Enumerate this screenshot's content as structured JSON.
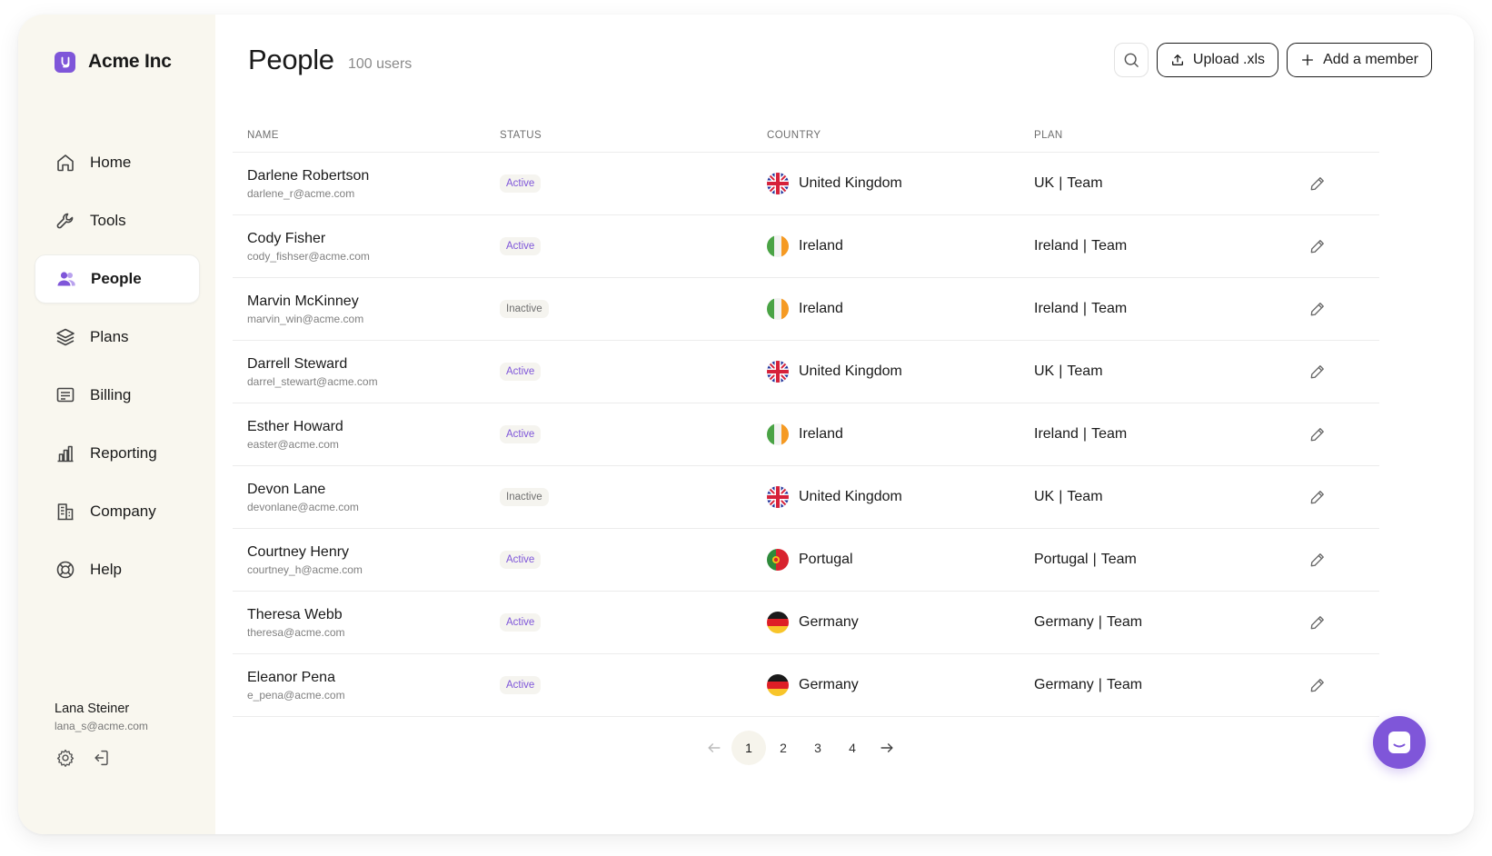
{
  "app": {
    "brand_name": "Acme Inc",
    "brand_letter": "y",
    "accent_color": "#7f56d9"
  },
  "sidebar": {
    "items": [
      {
        "label": "Home",
        "icon": "home-icon",
        "active": false
      },
      {
        "label": "Tools",
        "icon": "wrench-icon",
        "active": false
      },
      {
        "label": "People",
        "icon": "people-icon",
        "active": true
      },
      {
        "label": "Plans",
        "icon": "layers-icon",
        "active": false
      },
      {
        "label": "Billing",
        "icon": "receipt-icon",
        "active": false
      },
      {
        "label": "Reporting",
        "icon": "bar-chart-icon",
        "active": false
      },
      {
        "label": "Company",
        "icon": "building-icon",
        "active": false
      },
      {
        "label": "Help",
        "icon": "lifebuoy-icon",
        "active": false
      }
    ]
  },
  "user": {
    "name": "Lana Steiner",
    "email": "lana_s@acme.com"
  },
  "header": {
    "title": "People",
    "count": "100 users",
    "upload_label": "Upload .xls",
    "add_label": "Add a member"
  },
  "table": {
    "columns": [
      "NAME",
      "STATUS",
      "COUNTRY",
      "PLAN"
    ],
    "rows": [
      {
        "name": "Darlene Robertson",
        "email": "darlene_r@acme.com",
        "status": "Active",
        "country": "United Kingdom",
        "flag": "uk",
        "plan_region": "UK",
        "plan_tier": "Team"
      },
      {
        "name": "Cody Fisher",
        "email": "cody_fishser@acme.com",
        "status": "Active",
        "country": "Ireland",
        "flag": "ie",
        "plan_region": "Ireland",
        "plan_tier": "Team"
      },
      {
        "name": "Marvin McKinney",
        "email": "marvin_win@acme.com",
        "status": "Inactive",
        "country": "Ireland",
        "flag": "ie",
        "plan_region": "Ireland",
        "plan_tier": "Team"
      },
      {
        "name": "Darrell Steward",
        "email": "darrel_stewart@acme.com",
        "status": "Active",
        "country": "United Kingdom",
        "flag": "uk",
        "plan_region": "UK",
        "plan_tier": "Team"
      },
      {
        "name": "Esther Howard",
        "email": "easter@acme.com",
        "status": "Active",
        "country": "Ireland",
        "flag": "ie",
        "plan_region": "Ireland",
        "plan_tier": "Team"
      },
      {
        "name": "Devon Lane",
        "email": "devonlane@acme.com",
        "status": "Inactive",
        "country": "United Kingdom",
        "flag": "uk",
        "plan_region": "UK",
        "plan_tier": "Team"
      },
      {
        "name": "Courtney Henry",
        "email": "courtney_h@acme.com",
        "status": "Active",
        "country": "Portugal",
        "flag": "pt",
        "plan_region": "Portugal",
        "plan_tier": "Team"
      },
      {
        "name": "Theresa Webb",
        "email": "theresa@acme.com",
        "status": "Active",
        "country": "Germany",
        "flag": "de",
        "plan_region": "Germany",
        "plan_tier": "Team"
      },
      {
        "name": "Eleanor Pena",
        "email": "e_pena@acme.com",
        "status": "Active",
        "country": "Germany",
        "flag": "de",
        "plan_region": "Germany",
        "plan_tier": "Team"
      }
    ]
  },
  "pagination": {
    "pages": [
      "1",
      "2",
      "3",
      "4"
    ],
    "current": "1"
  }
}
